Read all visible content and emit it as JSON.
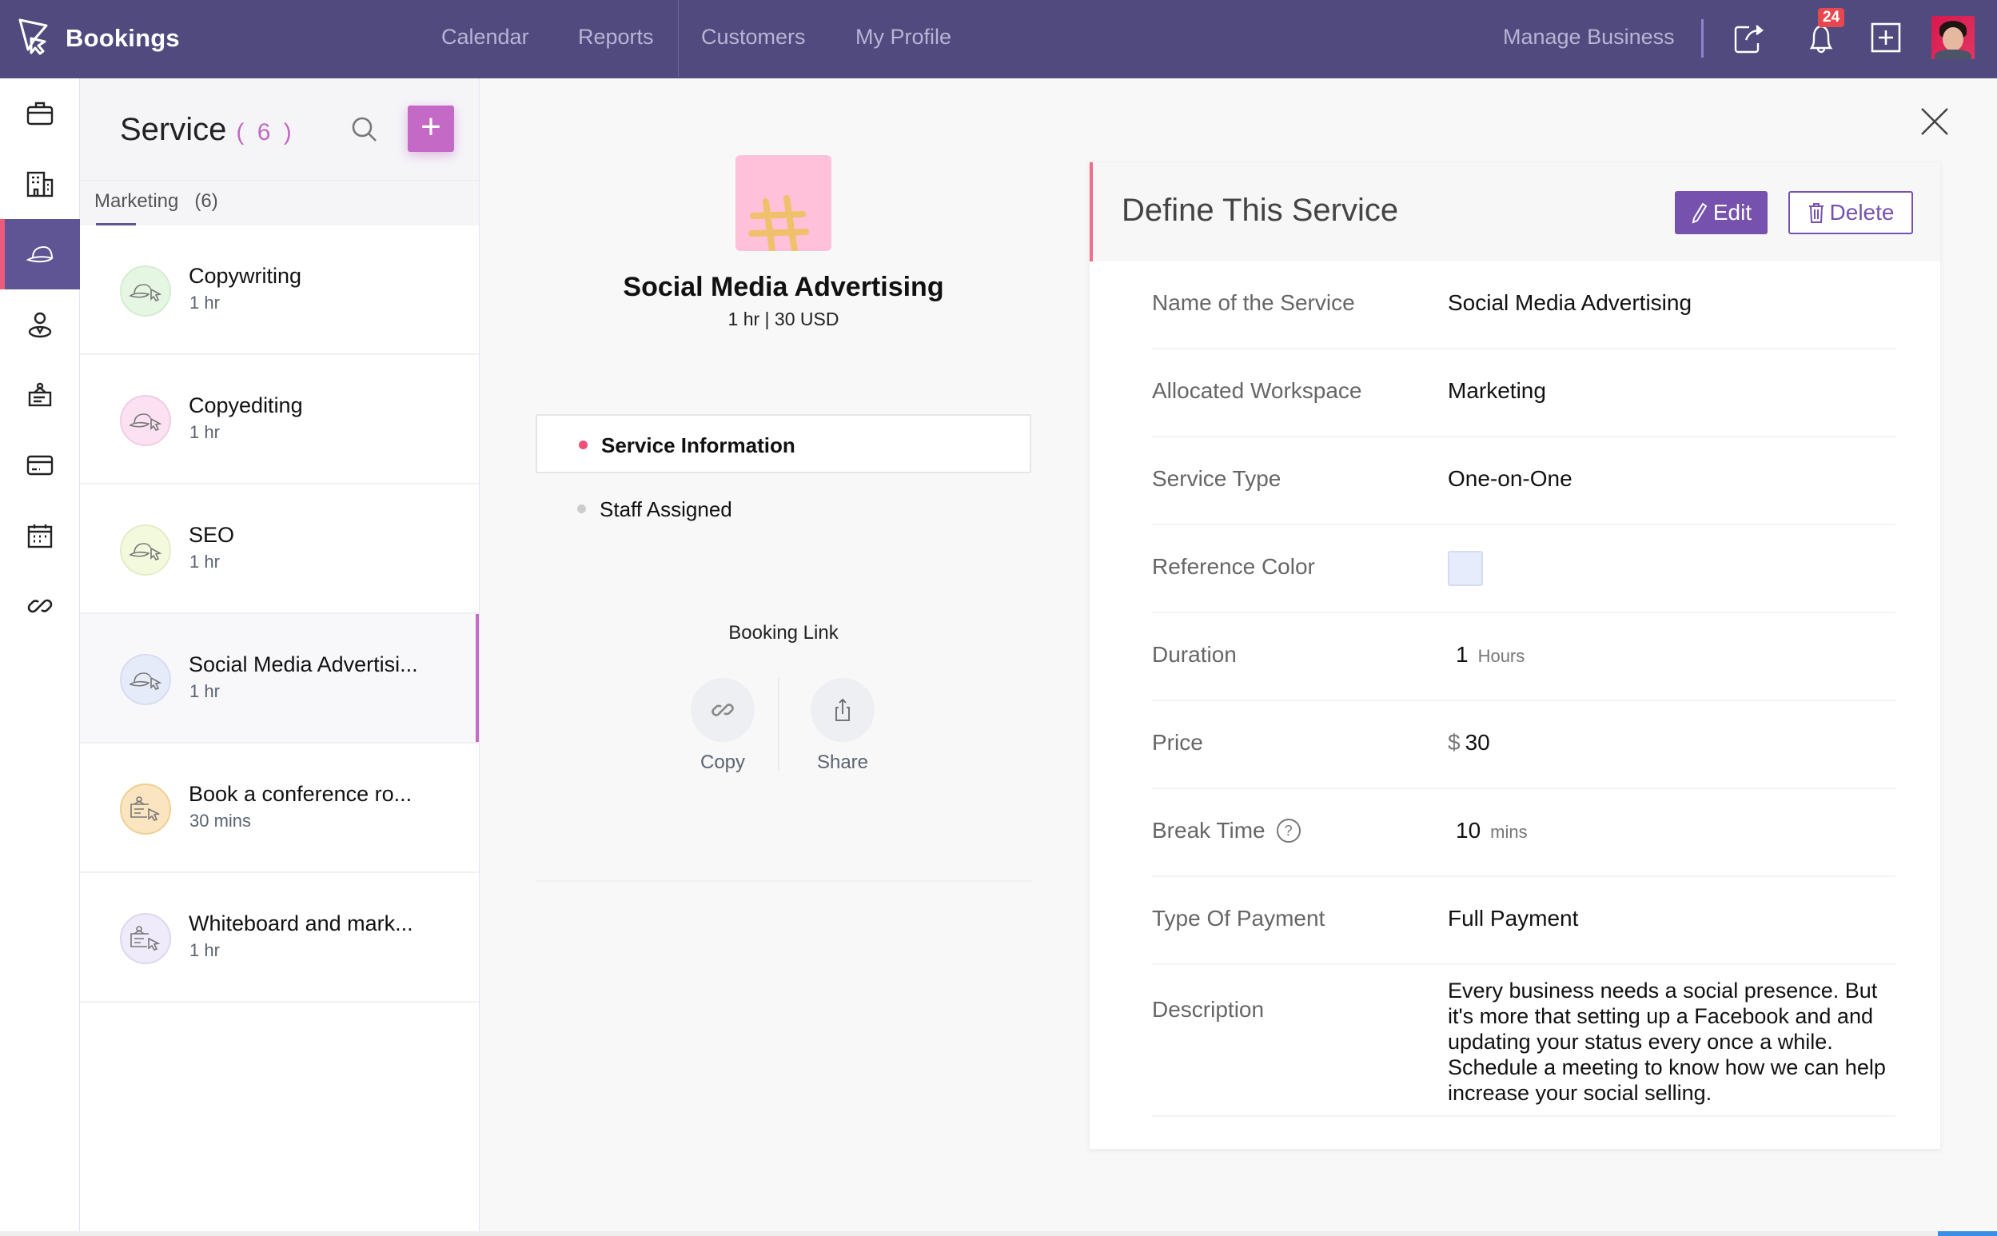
{
  "app": {
    "name": "Bookings",
    "colors": {
      "header": "#504a7e",
      "accent": "#c46ac6",
      "primary": "#7652ae",
      "active_marker": "#ee5a7c"
    }
  },
  "header": {
    "nav": [
      "Calendar",
      "Reports",
      "Customers",
      "My Profile"
    ],
    "manage_business": "Manage Business",
    "icons": [
      "share-icon",
      "bell-icon",
      "add-icon",
      "avatar"
    ],
    "notification_count": "24"
  },
  "rail": {
    "items": [
      {
        "icon": "briefcase-icon",
        "active": false
      },
      {
        "icon": "building-icon",
        "active": false
      },
      {
        "icon": "cap-icon",
        "active": true
      },
      {
        "icon": "staff-icon",
        "active": false
      },
      {
        "icon": "signboard-icon",
        "active": false
      },
      {
        "icon": "card-icon",
        "active": false
      },
      {
        "icon": "calendar-icon",
        "active": false
      },
      {
        "icon": "link-icon",
        "active": false
      }
    ]
  },
  "service_list": {
    "title": "Service",
    "count": "( 6 )",
    "group": "Marketing   (6)",
    "items": [
      {
        "name": "Copywriting",
        "duration": "1 hr",
        "color": "#e5f7e3",
        "border": "#d5ecd3",
        "icon": "cap-icon"
      },
      {
        "name": "Copyediting",
        "duration": "1 hr",
        "color": "#fbe1f1",
        "border": "#f2cde4",
        "icon": "cap-icon"
      },
      {
        "name": "SEO",
        "duration": "1 hr",
        "color": "#f3f9dd",
        "border": "#e4edc8",
        "icon": "cap-icon"
      },
      {
        "name": "Social Media Advertisi...",
        "duration": "1 hr",
        "color": "#e6ebfa",
        "border": "#d5ddf2",
        "icon": "cap-icon",
        "active": true
      },
      {
        "name": "Book a conference ro...",
        "duration": "30 mins",
        "color": "#fbe4c0",
        "border": "#efcf94",
        "icon": "signboard-icon"
      },
      {
        "name": "Whiteboard and mark...",
        "duration": "1 hr",
        "color": "#efebfa",
        "border": "#ddd7ef",
        "icon": "signboard-icon"
      }
    ]
  },
  "detail": {
    "title": "Social Media Advertising",
    "subtitle": "1 hr | 30 USD",
    "tabs": [
      {
        "label": "Service Information",
        "active": true,
        "dot": "#ee4f77"
      },
      {
        "label": "Staff Assigned",
        "active": false,
        "dot": "#cccccc"
      }
    ],
    "booking_link": {
      "title": "Booking Link",
      "copy": "Copy",
      "share": "Share"
    }
  },
  "card": {
    "title": "Define This Service",
    "edit": "Edit",
    "delete": "Delete",
    "fields": {
      "name": {
        "label": "Name of the Service",
        "value": "Social Media Advertising"
      },
      "workspace": {
        "label": "Allocated Workspace",
        "value": "Marketing"
      },
      "type": {
        "label": "Service Type",
        "value": "One-on-One"
      },
      "color": {
        "label": "Reference Color",
        "value": "#e6ecfb"
      },
      "duration": {
        "label": "Duration",
        "value": "1",
        "unit": "Hours"
      },
      "price": {
        "label": "Price",
        "currency": "$",
        "value": "30"
      },
      "break": {
        "label": "Break Time",
        "value": "10",
        "unit": "mins",
        "help": "?"
      },
      "payment": {
        "label": "Type Of Payment",
        "value": "Full Payment"
      },
      "description": {
        "label": "Description",
        "value": "Every business needs a social presence. But it's more that setting up a Facebook and and updating your status every once a while. Schedule a meeting to know how we can help increase your social selling."
      }
    }
  }
}
